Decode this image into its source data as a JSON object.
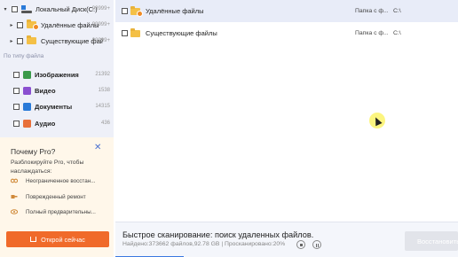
{
  "tree": {
    "items": [
      {
        "label": "Локальный Диск(C:)",
        "count": "99999+",
        "icon": "drive-icon"
      },
      {
        "label": "Удалённые файлы",
        "count": "99999+",
        "icon": "folder-deleted-icon"
      },
      {
        "label": "Существующие фай...",
        "count": "99999+",
        "icon": "folder-icon"
      }
    ]
  },
  "by_type": {
    "heading": "По типу файла",
    "items": [
      {
        "label": "Изображения",
        "count": "21392",
        "color": "#3a9a4a"
      },
      {
        "label": "Видео",
        "count": "1538",
        "color": "#8a4fd0"
      },
      {
        "label": "Документы",
        "count": "14315",
        "color": "#2a7ad8"
      },
      {
        "label": "Аудио",
        "count": "436",
        "color": "#e8703a"
      }
    ]
  },
  "promo": {
    "title": "Почему Pro?",
    "subtitle": "Разблокируйте Pro, чтобы наслаждаться:",
    "features": [
      {
        "label": "Неограниченное восстан...",
        "icon": "infinity-icon"
      },
      {
        "label": "Поврежденный ремонт",
        "icon": "repair-icon"
      },
      {
        "label": "Полный предварительны...",
        "icon": "eye-icon"
      }
    ],
    "order_label": "Открой сейчас",
    "accent": "#f06a2a"
  },
  "files": [
    {
      "name": "Удалённые файлы",
      "path": "Папка с ф...",
      "drive": "C:\\",
      "selected": true
    },
    {
      "name": "Существующие файлы",
      "path": "Папка с ф...",
      "drive": "C:\\",
      "selected": false
    }
  ],
  "status": {
    "title": "Быстрое сканирование: поиск удаленных файлов.",
    "detail": "Найдено:373662 файлов,92.78 GB | Просканировано:20%",
    "progress_fraction": 0.2,
    "recover_label": "Восстановить"
  }
}
